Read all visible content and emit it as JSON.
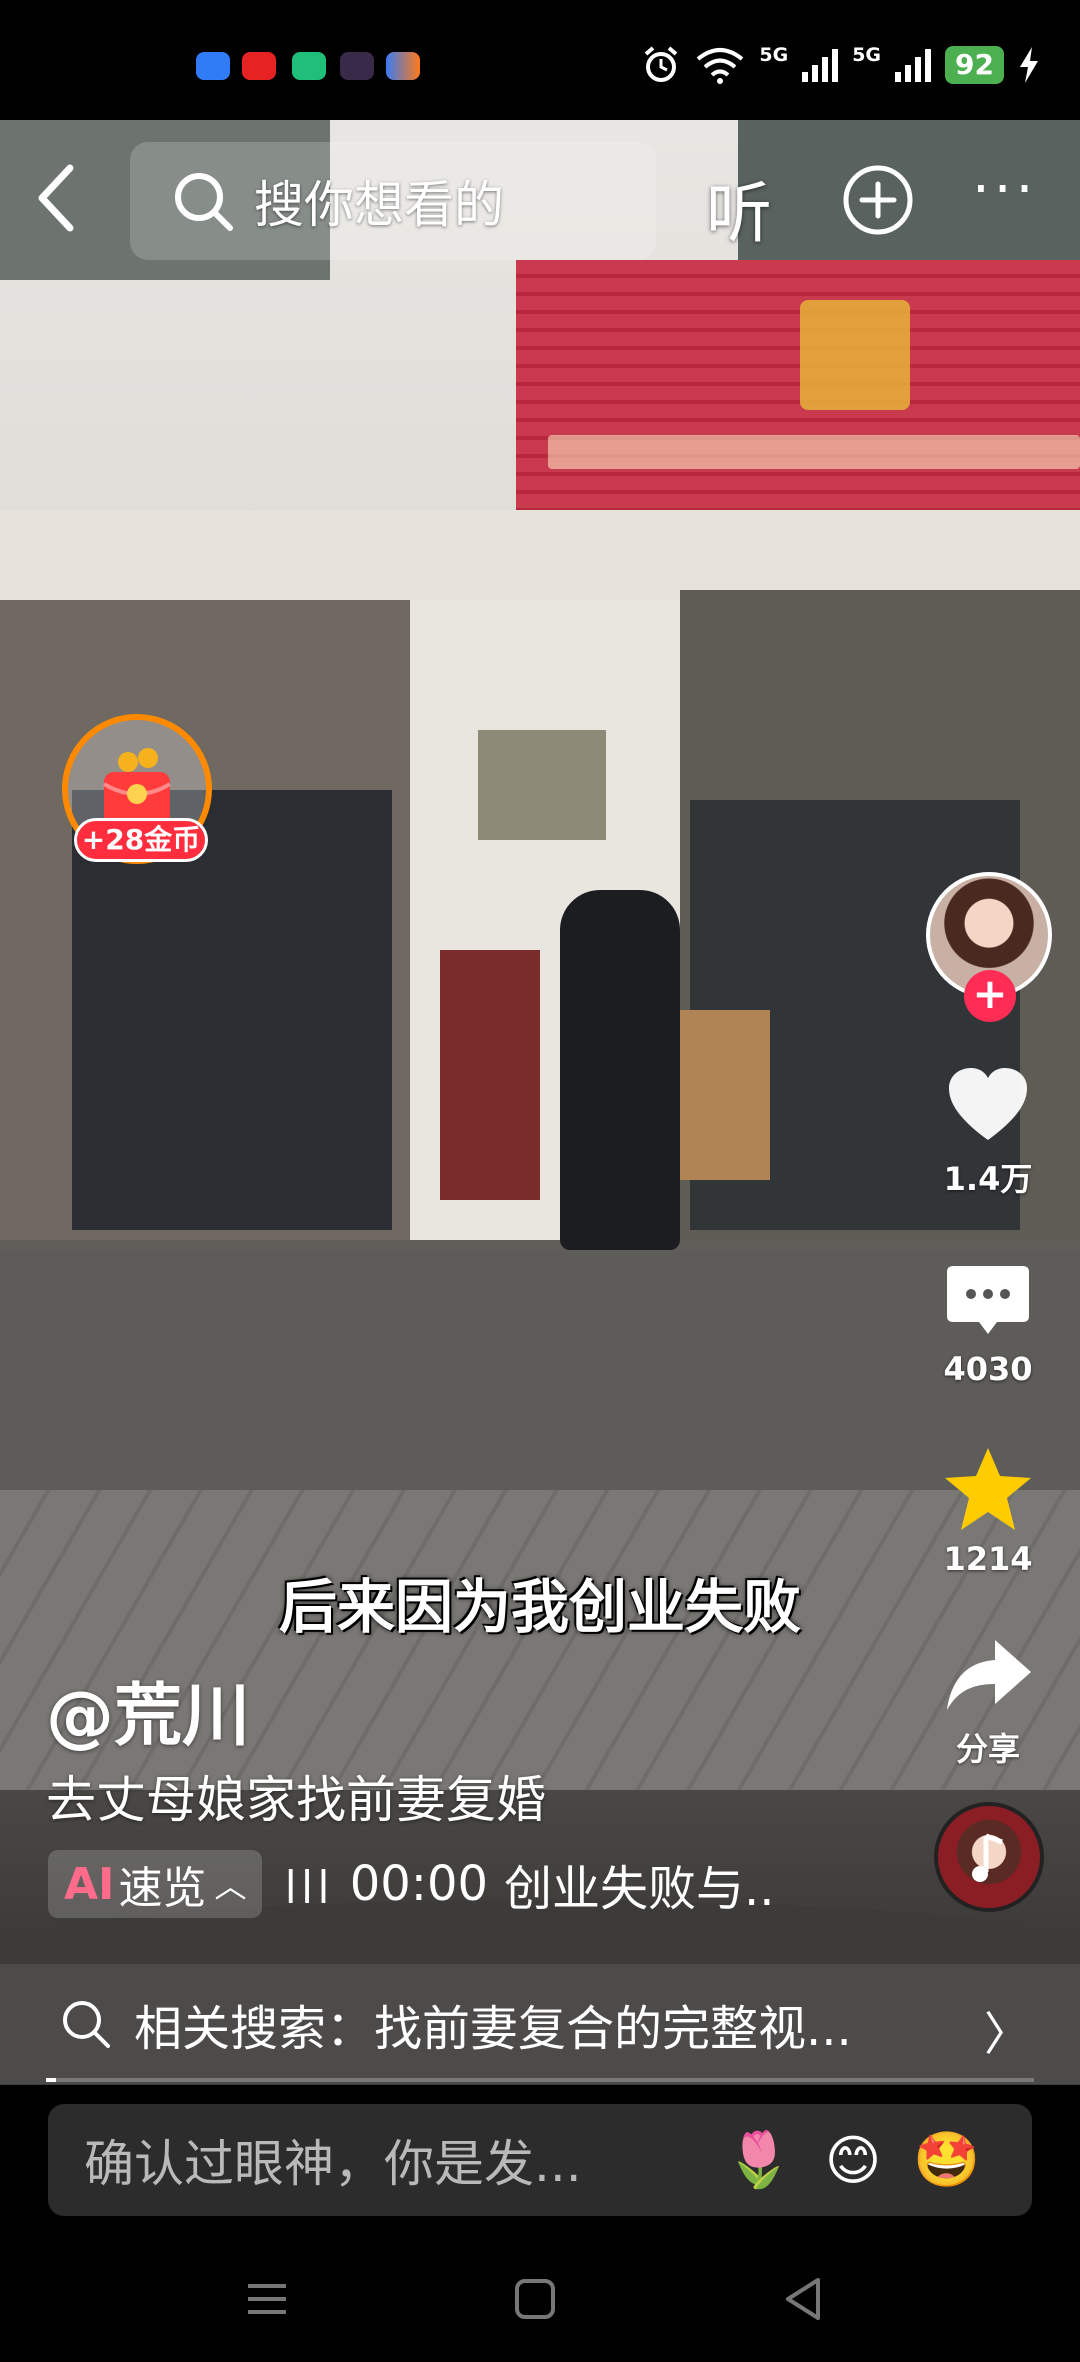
{
  "status_bar": {
    "network_1": "5G",
    "network_2": "5G",
    "battery": "92"
  },
  "top_bar": {
    "search_placeholder": "搜你想看的",
    "listen_label": "听",
    "more_label": "···"
  },
  "coin_widget": {
    "label": "+28金币"
  },
  "actions": {
    "like_count": "1.4万",
    "comment_count": "4030",
    "favorite_count": "1214",
    "share_label": "分享"
  },
  "video": {
    "subtitle": "后来因为我创业失败",
    "author": "@荒川",
    "description": "去丈母娘家找前妻复婚",
    "progress": 0.01
  },
  "ai_summary": {
    "chip_ai": "AI",
    "chip_label": "速览",
    "time": "00:00",
    "text": "创业失败与.."
  },
  "related_search": {
    "label": "相关搜索：找前妻复合的完整视..."
  },
  "comment_bar": {
    "placeholder": "确认过眼神，你是发...",
    "emojis": [
      "🌷",
      "😊",
      "🤩"
    ]
  },
  "colors": {
    "accent_red": "#ff2c55",
    "coin_orange": "#ff8a00",
    "battery_green": "#4caf50",
    "star_yellow": "#ffcc00"
  },
  "icons": {
    "back": "chevron-left-icon",
    "search": "search-icon",
    "add": "plus-circle-icon",
    "more": "more-dots-icon",
    "like": "heart-icon",
    "comment": "comment-bubble-icon",
    "favorite": "star-icon",
    "share": "share-arrow-icon"
  }
}
